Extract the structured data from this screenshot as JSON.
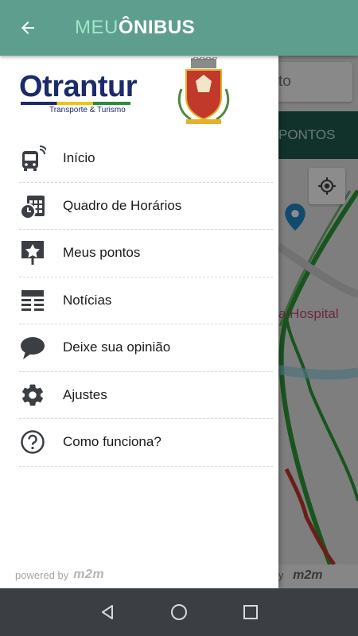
{
  "app": {
    "logo_light": "MEU",
    "logo_bold": "ÔNIBUS"
  },
  "drawer": {
    "company_name": "Otrantur",
    "company_subtitle": "Transporte & Turismo",
    "menu": [
      {
        "label": "Início",
        "icon": "bus-icon"
      },
      {
        "label": "Quadro de Horários",
        "icon": "schedule-icon"
      },
      {
        "label": "Meus pontos",
        "icon": "star-stop-icon"
      },
      {
        "label": "Notícias",
        "icon": "news-icon"
      },
      {
        "label": "Deixe sua opinião",
        "icon": "chat-bubble-icon"
      },
      {
        "label": "Ajustes",
        "icon": "gear-icon"
      },
      {
        "label": "Como funciona?",
        "icon": "help-icon"
      }
    ],
    "powered_by": "powered by",
    "powered_brand": "m2m"
  },
  "map": {
    "search_placeholder_fragment": "to",
    "tab_fragment": "PONTOS",
    "place_label_fragment": "a Hospital",
    "powered_fragment": "y",
    "powered_brand": "m2m"
  },
  "colors": {
    "appbar": "#5e9e8f",
    "logo_light": "#9ee6c8",
    "company": "#1b2a6b",
    "tabbar": "#1f5b4e"
  }
}
